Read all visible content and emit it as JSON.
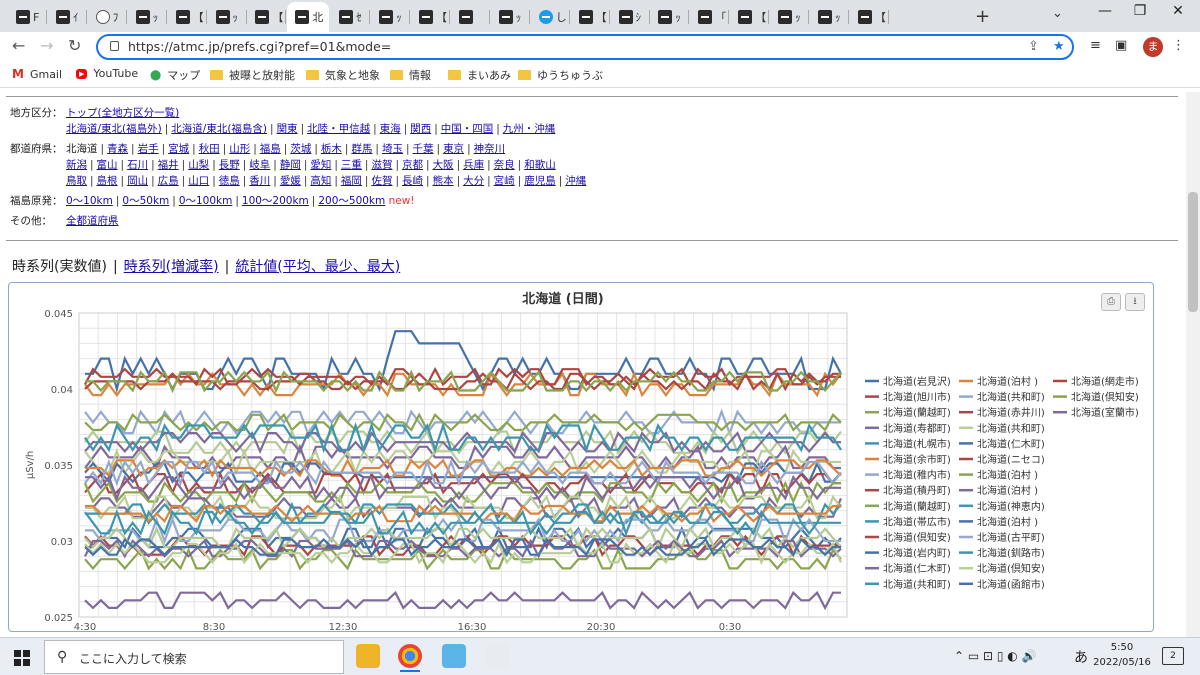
{
  "browser": {
    "tabs": [
      {
        "title": "F",
        "fav": "dark"
      },
      {
        "title": "ｲ",
        "fav": "dark"
      },
      {
        "title": "ﾌ",
        "fav": "info"
      },
      {
        "title": "ｯ",
        "fav": "dark"
      },
      {
        "title": "【",
        "fav": "dark"
      },
      {
        "title": "ｯ",
        "fav": "dark"
      },
      {
        "title": "【",
        "fav": "dark"
      },
      {
        "title": "北",
        "fav": "dark",
        "active": true
      },
      {
        "title": "ｾ",
        "fav": "dark"
      },
      {
        "title": "ｯ",
        "fav": "dark"
      },
      {
        "title": "【",
        "fav": "dark"
      },
      {
        "title": "",
        "fav": "dark"
      },
      {
        "title": "ｯ",
        "fav": "dark"
      },
      {
        "title": "し",
        "fav": "tw"
      },
      {
        "title": "【",
        "fav": "dark"
      },
      {
        "title": "ｼ",
        "fav": "dark"
      },
      {
        "title": "ｯ",
        "fav": "dark"
      },
      {
        "title": "「",
        "fav": "dark"
      },
      {
        "title": "【",
        "fav": "dark"
      },
      {
        "title": "ｯ",
        "fav": "dark"
      },
      {
        "title": "ｯ",
        "fav": "dark"
      },
      {
        "title": "【",
        "fav": "dark"
      }
    ],
    "url": "https://atmc.jp/prefs.cgi?pref=01&mode=",
    "profile_initial": "ま",
    "bookmarks": [
      {
        "label": "Gmail",
        "type": "gmail"
      },
      {
        "label": "YouTube",
        "type": "youtube"
      },
      {
        "label": "マップ",
        "type": "maps"
      },
      {
        "label": "被曝と放射能",
        "type": "folder"
      },
      {
        "label": "気象と地象",
        "type": "folder"
      },
      {
        "label": "情報",
        "type": "folder"
      },
      {
        "label": "まいあみ",
        "type": "folder"
      },
      {
        "label": "ゆうちゅうぶ",
        "type": "folder"
      }
    ]
  },
  "nav": {
    "region_label": "地方区分：",
    "region_top": "トップ(全地方区分一覧)",
    "regions": [
      "北海道/東北(福島外)",
      "北海道/東北(福島含)",
      "関東",
      "北陸・甲信越",
      "東海",
      "関西",
      "中国・四国",
      "九州・沖縄"
    ],
    "pref_label": "都道府県：",
    "pref_current": "北海道",
    "prefs_row1": [
      "青森",
      "岩手",
      "宮城",
      "秋田",
      "山形",
      "福島",
      "茨城",
      "栃木",
      "群馬",
      "埼玉",
      "千葉",
      "東京",
      "神奈川"
    ],
    "prefs_row2": [
      "新潟",
      "富山",
      "石川",
      "福井",
      "山梨",
      "長野",
      "岐阜",
      "静岡",
      "愛知",
      "三重",
      "滋賀",
      "京都",
      "大阪",
      "兵庫",
      "奈良",
      "和歌山"
    ],
    "prefs_row3": [
      "鳥取",
      "島根",
      "岡山",
      "広島",
      "山口",
      "徳島",
      "香川",
      "愛媛",
      "高知",
      "福岡",
      "佐賀",
      "長崎",
      "熊本",
      "大分",
      "宮崎",
      "鹿児島",
      "沖縄"
    ],
    "fukushima_label": "福島原発：",
    "fukushima": [
      "0～10km",
      "0～50km",
      "0～100km",
      "100～200km",
      "200～500km"
    ],
    "new_badge": "new!",
    "other_label": "その他：",
    "other_link": "全都道府県"
  },
  "view_tabs": {
    "current": "時系列(実数値)",
    "growth": "時系列(増減率)",
    "stats": "統計値(平均、最少、最大)"
  },
  "chart_data": {
    "type": "line",
    "title": "北海道",
    "subtitle": "(日間)",
    "ylabel": "μSv/h",
    "ylim": [
      0.025,
      0.045
    ],
    "yticks": [
      "0.045",
      "0.04",
      "0.035",
      "0.03",
      "0.025"
    ],
    "xticks": [
      "4:30",
      "8:30",
      "12:30",
      "16:30",
      "20:30",
      "0:30"
    ],
    "legend_position": "right",
    "grid": true,
    "series": [
      {
        "name": "北海道(岩見沢)",
        "color": "#4572a7",
        "base": 0.041,
        "amp": 0.001,
        "seed": 1
      },
      {
        "name": "北海道(泊村 )",
        "color": "#db843d",
        "base": 0.0403,
        "amp": 0.0007,
        "seed": 2
      },
      {
        "name": "北海道(網走市)",
        "color": "#aa4643",
        "base": 0.0408,
        "amp": 0.0005,
        "seed": 3
      },
      {
        "name": "北海道(旭川市)",
        "color": "#aa4643",
        "base": 0.0405,
        "amp": 0.0005,
        "seed": 4
      },
      {
        "name": "北海道(共和町)",
        "color": "#93a9cf",
        "base": 0.0378,
        "amp": 0.0007,
        "seed": 5
      },
      {
        "name": "北海道(倶知安)",
        "color": "#89a54e",
        "base": 0.0405,
        "amp": 0.0006,
        "seed": 6
      },
      {
        "name": "北海道(蘭越町)",
        "color": "#89a54e",
        "base": 0.0378,
        "amp": 0.0005,
        "seed": 7
      },
      {
        "name": "北海道(赤井川)",
        "color": "#b5ca92",
        "base": 0.0365,
        "amp": 0.0007,
        "seed": 8
      },
      {
        "name": "北海道(室蘭市)",
        "color": "#80699b",
        "base": 0.0365,
        "amp": 0.0006,
        "seed": 9
      },
      {
        "name": "北海道(寿都町)",
        "color": "#80699b",
        "base": 0.0355,
        "amp": 0.0007,
        "seed": 10
      },
      {
        "name": "北海道(共和町)",
        "color": "#b9cd96",
        "base": 0.0352,
        "amp": 0.0007,
        "seed": 11
      },
      {
        "name": "北海道(札幌市)",
        "color": "#3d96ae",
        "base": 0.0368,
        "amp": 0.0008,
        "seed": 12
      },
      {
        "name": "北海道(仁木町)",
        "color": "#4572a7",
        "base": 0.0345,
        "amp": 0.0006,
        "seed": 13
      },
      {
        "name": "北海道(余市町)",
        "color": "#db843d",
        "base": 0.0348,
        "amp": 0.0005,
        "seed": 14
      },
      {
        "name": "北海道(ニセコ)",
        "color": "#aa4643",
        "base": 0.0338,
        "amp": 0.0006,
        "seed": 15
      },
      {
        "name": "北海道(稚内市)",
        "color": "#93a9cf",
        "base": 0.0345,
        "amp": 0.0007,
        "seed": 16
      },
      {
        "name": "北海道(泊村 )",
        "color": "#89a54e",
        "base": 0.0332,
        "amp": 0.0006,
        "seed": 17
      },
      {
        "name": "北海道(積丹町)",
        "color": "#80699b",
        "base": 0.0335,
        "amp": 0.0007,
        "seed": 18
      },
      {
        "name": "北海道(泊村 )",
        "color": "#80699b",
        "base": 0.0322,
        "amp": 0.0006,
        "seed": 19
      },
      {
        "name": "北海道(蘭越町)",
        "color": "#b9cd96",
        "base": 0.0322,
        "amp": 0.0007,
        "seed": 20
      },
      {
        "name": "北海道(神恵内)",
        "color": "#3d96ae",
        "base": 0.0318,
        "amp": 0.0006,
        "seed": 21
      },
      {
        "name": "北海道(帯広市)",
        "color": "#4572a7",
        "base": 0.0302,
        "amp": 0.0006,
        "seed": 22
      },
      {
        "name": "北海道(泊村 )",
        "color": "#db843d",
        "base": 0.0318,
        "amp": 0.0005,
        "seed": 23
      },
      {
        "name": "北海道(倶知安)",
        "color": "#aa4643",
        "base": 0.0297,
        "amp": 0.0006,
        "seed": 24
      },
      {
        "name": "北海道(古平町)",
        "color": "#93a9cf",
        "base": 0.0307,
        "amp": 0.0007,
        "seed": 25
      },
      {
        "name": "北海道(岩内町)",
        "color": "#89a54e",
        "base": 0.0288,
        "amp": 0.0006,
        "seed": 26
      },
      {
        "name": "北海道(釧路市)",
        "color": "#b5ca92",
        "base": 0.0302,
        "amp": 0.0006,
        "seed": 27
      },
      {
        "name": "北海道(仁木町)",
        "color": "#80699b",
        "base": 0.0295,
        "amp": 0.0005,
        "seed": 28
      },
      {
        "name": "北海道(倶知安)",
        "color": "#b9cd96",
        "base": 0.0292,
        "amp": 0.0006,
        "seed": 29
      },
      {
        "name": "北海道(共和町)",
        "color": "#3d96ae",
        "base": 0.0312,
        "amp": 0.0007,
        "seed": 30
      },
      {
        "name": "北海道(函館市)",
        "color": "#4572a7",
        "base": 0.0296,
        "amp": 0.0005,
        "seed": 31
      },
      {
        "name": "北海道(室蘭市)",
        "color": "#80699b",
        "base": 0.0261,
        "amp": 0.0005,
        "seed": 32
      }
    ],
    "legend_columns": [
      [
        "北海道(岩見沢)",
        "北海道(旭川市)",
        "北海道(蘭越町)",
        "北海道(寿都町)",
        "北海道(札幌市)",
        "北海道(余市町)",
        "北海道(稚内市)",
        "北海道(積丹町)",
        "北海道(蘭越町)",
        "北海道(帯広市)",
        "北海道(倶知安)",
        "北海道(岩内町)",
        "北海道(仁木町)",
        "北海道(共和町)"
      ],
      [
        "北海道(泊村 )",
        "北海道(共和町)",
        "北海道(赤井川)",
        "北海道(共和町)",
        "北海道(仁木町)",
        "北海道(ニセコ)",
        "北海道(泊村 )",
        "北海道(泊村 )",
        "北海道(神恵内)",
        "北海道(泊村 )",
        "北海道(古平町)",
        "北海道(釧路市)",
        "北海道(倶知安)",
        "北海道(函館市)"
      ],
      [
        "北海道(網走市)",
        "北海道(倶知安)",
        "北海道(室蘭市)"
      ]
    ],
    "legend_colors": [
      [
        "#4572a7",
        "#aa4643",
        "#89a54e",
        "#80699b",
        "#3d96ae",
        "#db843d",
        "#93a9cf",
        "#aa4643",
        "#89a54e",
        "#3d96ae",
        "#aa4643",
        "#4572a7",
        "#80699b",
        "#3d96ae"
      ],
      [
        "#db843d",
        "#93a9cf",
        "#aa4643",
        "#b9cd96",
        "#4572a7",
        "#aa4643",
        "#89a54e",
        "#80699b",
        "#3d96ae",
        "#4572a7",
        "#93a9cf",
        "#3d96ae",
        "#b9cd96",
        "#4572a7"
      ],
      [
        "#aa4643",
        "#89a54e",
        "#80699b"
      ]
    ]
  },
  "taskbar": {
    "search_placeholder": "ここに入力して検索",
    "time": "5:50",
    "date": "2022/05/16",
    "ime": "あ",
    "notifications": "2"
  }
}
